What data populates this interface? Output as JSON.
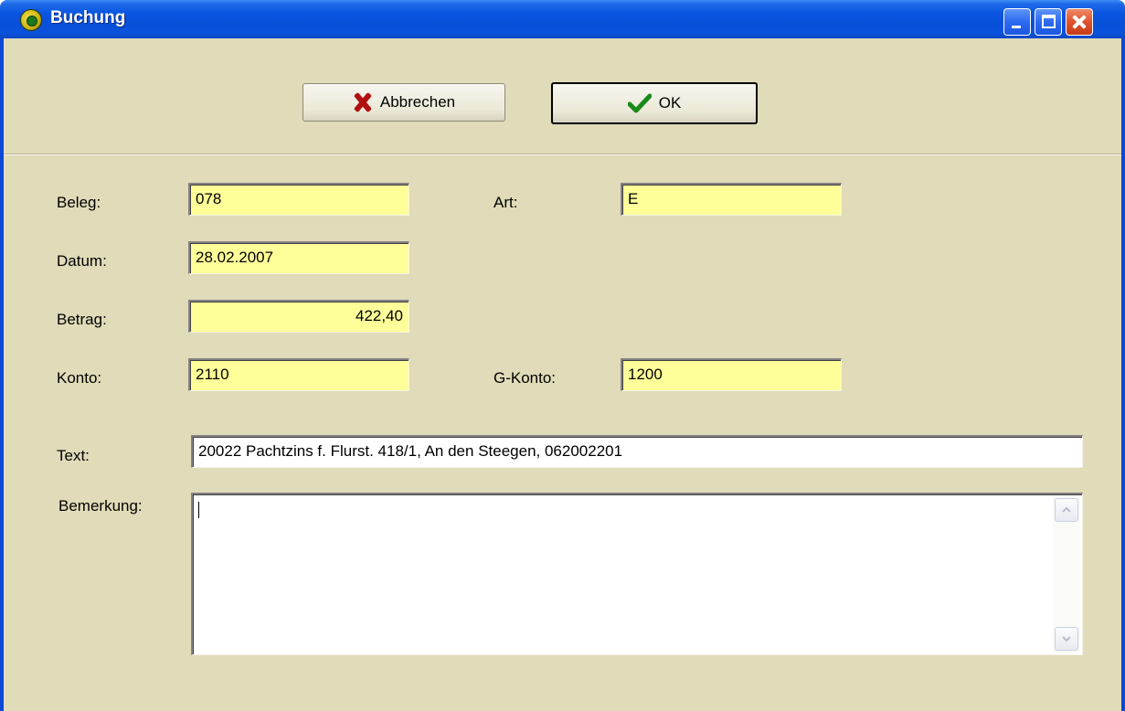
{
  "window": {
    "title": "Buchung",
    "controls": {
      "minimize": "minimize",
      "maximize": "maximize",
      "close": "close"
    }
  },
  "toolbar": {
    "cancel_label": "Abbrechen",
    "ok_label": "OK"
  },
  "form": {
    "beleg": {
      "label": "Beleg:",
      "value": "078"
    },
    "art": {
      "label": "Art:",
      "value": "E"
    },
    "datum": {
      "label": "Datum:",
      "value": "28.02.2007"
    },
    "betrag": {
      "label": "Betrag:",
      "value": "422,40"
    },
    "konto": {
      "label": "Konto:",
      "value": "2110"
    },
    "gkonto": {
      "label": "G-Konto:",
      "value": "1200"
    },
    "text": {
      "label": "Text:",
      "value": "20022 Pachtzins  f. Flurst. 418/1, An den Steegen, 062002201"
    },
    "bemerkung": {
      "label": "Bemerkung:",
      "value": ""
    }
  },
  "colors": {
    "dialog_bg": "#e0dbb8",
    "field_bg": "#ffff99",
    "titlebar": "#0a55e0"
  },
  "icons": {
    "app": "app-icon",
    "cancel": "x-icon",
    "ok": "checkmark-icon"
  }
}
